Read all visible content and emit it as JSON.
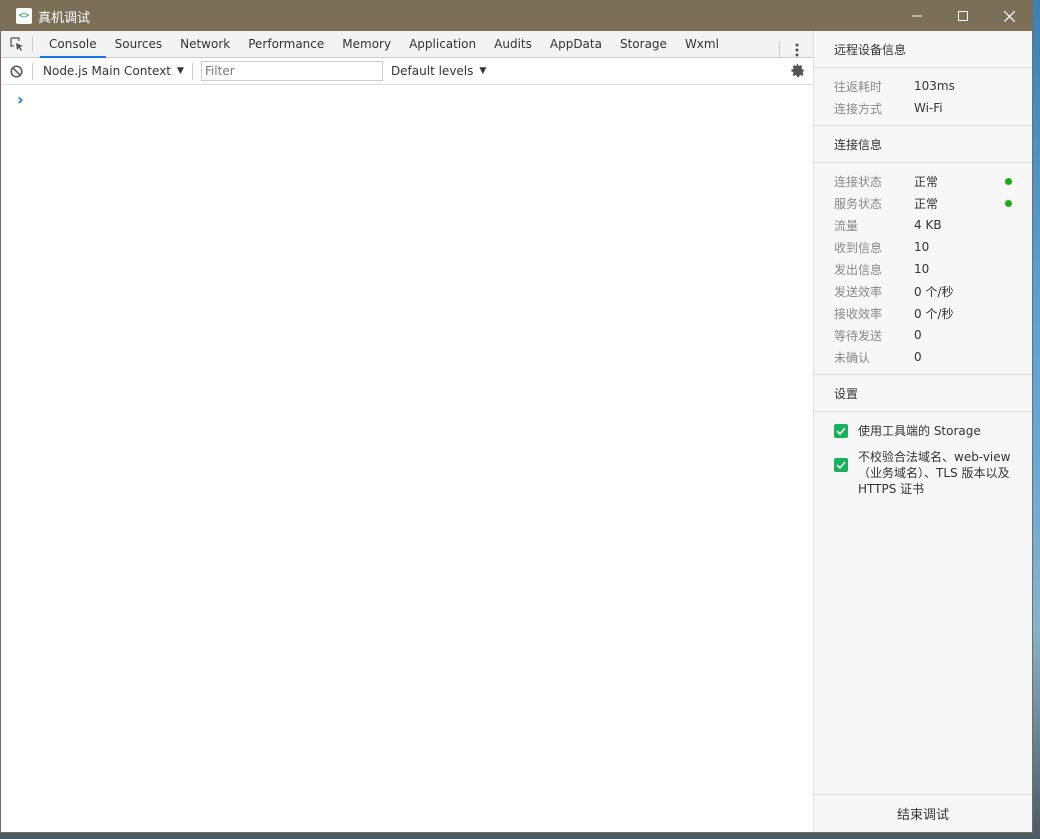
{
  "window": {
    "title": "真机调试",
    "app_icon": "<>",
    "controls": [
      "minimize-icon",
      "maximize-icon",
      "close-icon"
    ]
  },
  "devtools": {
    "tabs": [
      "Console",
      "Sources",
      "Network",
      "Performance",
      "Memory",
      "Application",
      "Audits",
      "AppData",
      "Storage",
      "Wxml"
    ],
    "active_tab": "Console",
    "toolbar": {
      "context": "Node.js Main Context",
      "filter_placeholder": "Filter",
      "levels": "Default levels"
    },
    "console_prompt": "›"
  },
  "side": {
    "remote_title": "远程设备信息",
    "remote": [
      {
        "key": "往返耗时",
        "value": "103ms"
      },
      {
        "key": "连接方式",
        "value": "Wi-Fi"
      }
    ],
    "conn_title": "连接信息",
    "conn": [
      {
        "key": "连接状态",
        "value": "正常",
        "status": "ok"
      },
      {
        "key": "服务状态",
        "value": "正常",
        "status": "ok"
      },
      {
        "key": "流量",
        "value": "4 KB"
      },
      {
        "key": "收到信息",
        "value": "10"
      },
      {
        "key": "发出信息",
        "value": "10"
      },
      {
        "key": "发送效率",
        "value": "0 个/秒"
      },
      {
        "key": "接收效率",
        "value": "0 个/秒"
      },
      {
        "key": "等待发送",
        "value": "0"
      },
      {
        "key": "未确认",
        "value": "0"
      }
    ],
    "settings_title": "设置",
    "settings": [
      {
        "label": "使用工具端的 Storage",
        "checked": true
      },
      {
        "label": "不校验合法域名、web-view（业务域名）、TLS 版本以及 HTTPS 证书",
        "checked": true
      }
    ],
    "end_button": "结束调试"
  },
  "colors": {
    "titlebar": "#7b6f57",
    "accent_tab": "#1a73e8",
    "status_ok": "#1aad19",
    "checkbox": "#17b35a"
  }
}
